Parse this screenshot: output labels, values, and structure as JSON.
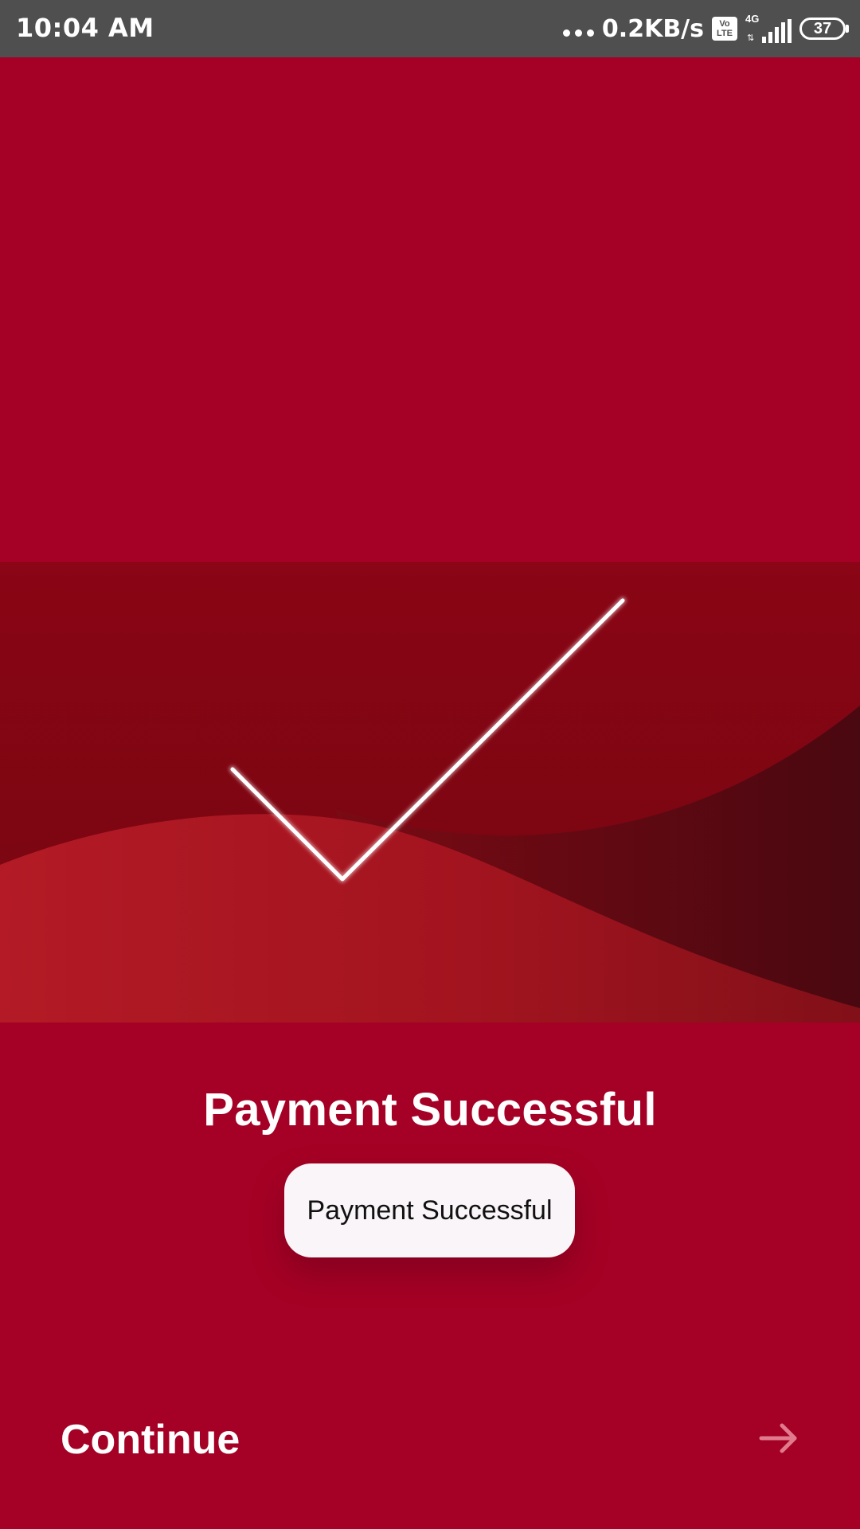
{
  "status_bar": {
    "time": "10:04 AM",
    "net_speed": "0.2KB/s",
    "volte_top": "Vo",
    "volte_bottom": "LTE",
    "network_type": "4G",
    "battery_level": "37"
  },
  "colors": {
    "background": "#a50025",
    "status_bar": "#4f4f4f",
    "hero_dark": "#7a0410",
    "hero_light_wave": "#b01922",
    "toast_bg": "#faf5f8"
  },
  "main": {
    "title": "Payment Successful",
    "check_icon": "checkmark-icon"
  },
  "toast": {
    "message": "Payment Successful"
  },
  "footer": {
    "continue_label": "Continue",
    "arrow_icon": "arrow-right-icon"
  }
}
